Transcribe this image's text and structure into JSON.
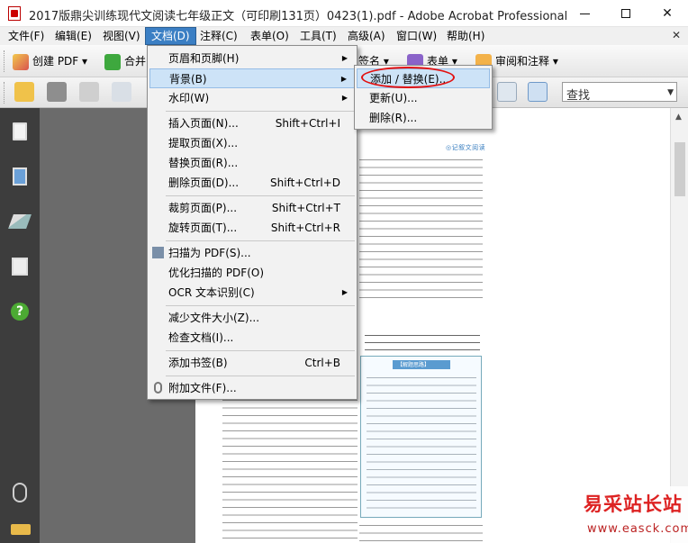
{
  "window": {
    "title": "2017版鼎尖训练现代文阅读七年级正文（可印刷131页）0423(1).pdf - Adobe Acrobat Professional",
    "minimize_icon": "minimize-icon",
    "maximize_icon": "maximize-icon",
    "close_label": "✕"
  },
  "menubar": {
    "items": [
      "文件(F)",
      "编辑(E)",
      "视图(V)",
      "文档(D)",
      "注释(C)",
      "表单(O)",
      "工具(T)",
      "高级(A)",
      "窗口(W)",
      "帮助(H)"
    ],
    "active": "文档(D)",
    "mdi_close": "✕"
  },
  "toolbar1": {
    "create_pdf": "创建 PDF",
    "merge": "合并",
    "sign": "签名",
    "forms": "表单",
    "review": "审阅和注释"
  },
  "toolbar2": {
    "search_placeholder": "查找"
  },
  "document_menu": {
    "items": [
      {
        "label": "页眉和页脚(H)",
        "shortcut": "",
        "submenu": true
      },
      {
        "label": "背景(B)",
        "shortcut": "",
        "submenu": true,
        "highlighted": true
      },
      {
        "label": "水印(W)",
        "shortcut": "",
        "submenu": true
      },
      {
        "label": "插入页面(N)...",
        "shortcut": "Shift+Ctrl+I"
      },
      {
        "label": "提取页面(X)...",
        "shortcut": ""
      },
      {
        "label": "替换页面(R)...",
        "shortcut": ""
      },
      {
        "label": "删除页面(D)...",
        "shortcut": "Shift+Ctrl+D"
      },
      {
        "label": "裁剪页面(P)...",
        "shortcut": "Shift+Ctrl+T"
      },
      {
        "label": "旋转页面(T)...",
        "shortcut": "Shift+Ctrl+R"
      },
      {
        "label": "扫描为 PDF(S)...",
        "shortcut": ""
      },
      {
        "label": "优化扫描的 PDF(O)",
        "shortcut": ""
      },
      {
        "label": "OCR 文本识别(C)",
        "shortcut": "",
        "submenu": true
      },
      {
        "label": "减少文件大小(Z)...",
        "shortcut": ""
      },
      {
        "label": "检查文档(I)...",
        "shortcut": ""
      },
      {
        "label": "添加书签(B)",
        "shortcut": "Ctrl+B"
      },
      {
        "label": "附加文件(F)...",
        "shortcut": ""
      }
    ]
  },
  "background_submenu": {
    "items": [
      {
        "label": "添加 / 替换(E)...",
        "highlighted": true
      },
      {
        "label": "更新(U)..."
      },
      {
        "label": "删除(R)..."
      }
    ]
  },
  "page": {
    "heading": "◎记叙文阅读",
    "sidebar_title": "【解题思路】"
  },
  "watermark": {
    "title": "易采站长站",
    "url": "www.easck.com"
  },
  "colors": {
    "menu_active": "#3b7fc4",
    "menu_highlight": "#cde3f7",
    "annotation_oval": "#e21010",
    "nav_pane": "#3d3d3d",
    "watermark": "#d22222"
  }
}
